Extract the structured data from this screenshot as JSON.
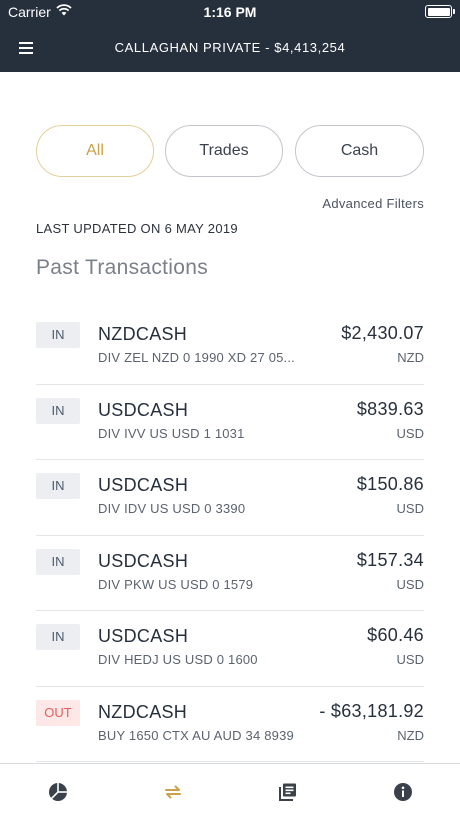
{
  "status_bar": {
    "carrier": "Carrier",
    "time": "1:16 PM"
  },
  "header": {
    "title": "CALLAGHAN PRIVATE - $4,413,254",
    "menu_icon": "hamburger-menu-icon"
  },
  "filters": {
    "all": "All",
    "trades": "Trades",
    "cash": "Cash",
    "selected": "All",
    "advanced": "Advanced Filters"
  },
  "last_updated": "LAST UPDATED ON 6 MAY 2019",
  "section_title": "Past Transactions",
  "transactions": [
    {
      "direction": "IN",
      "symbol": "NZDCASH",
      "description": "DIV ZEL NZD 0 1990 XD 27 05...",
      "amount": "$2,430.07",
      "currency": "NZD"
    },
    {
      "direction": "IN",
      "symbol": "USDCASH",
      "description": "DIV IVV US USD 1 1031",
      "amount": "$839.63",
      "currency": "USD"
    },
    {
      "direction": "IN",
      "symbol": "USDCASH",
      "description": "DIV IDV US USD 0 3390",
      "amount": "$150.86",
      "currency": "USD"
    },
    {
      "direction": "IN",
      "symbol": "USDCASH",
      "description": "DIV PKW US USD 0 1579",
      "amount": "$157.34",
      "currency": "USD"
    },
    {
      "direction": "IN",
      "symbol": "USDCASH",
      "description": "DIV HEDJ US USD 0 1600",
      "amount": "$60.46",
      "currency": "USD"
    },
    {
      "direction": "OUT",
      "symbol": "NZDCASH",
      "description": "BUY 1650 CTX AU AUD 34 8939",
      "amount": "- $63,181.92",
      "currency": "NZD"
    }
  ],
  "tab_bar": [
    {
      "icon": "pie-chart-icon",
      "active": false
    },
    {
      "icon": "transfer-arrows-icon",
      "active": true
    },
    {
      "icon": "documents-icon",
      "active": false
    },
    {
      "icon": "info-icon",
      "active": false
    }
  ],
  "colors": {
    "header_bg": "#26303d",
    "accent_gold": "#c9a14a",
    "out_red": "#e35d5d"
  }
}
